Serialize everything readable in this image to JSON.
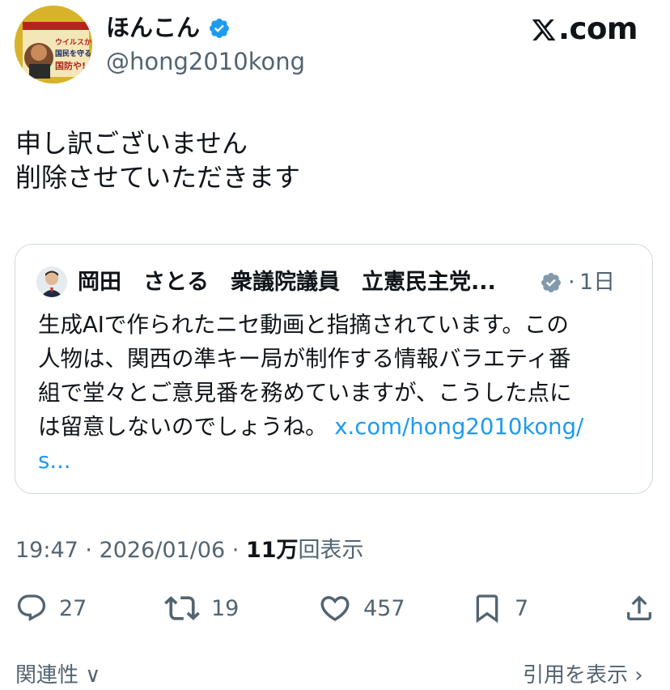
{
  "author": {
    "name": "ほんこん",
    "handle": "@hong2010kong",
    "avatar_text": "ウイルスから国民を守るのも国防や!"
  },
  "brand": {
    "label": ".com"
  },
  "tweet": {
    "lines": [
      "申し訳ございません",
      "削除させていただきます"
    ]
  },
  "quote": {
    "author": "岡田　さとる　衆議院議員　立憲民主党...",
    "dot": "·",
    "time": "1日",
    "lines": [
      "生成AIで作られたニセ動画と指摘されています。この",
      "人物は、関西の準キー局が制作する情報バラエティ番",
      "組で堂々とご意見番を務めていますが、こうした点に",
      "は留意しないのでしょうね。"
    ],
    "link_part1": "x.com/hong2010kong/",
    "link_part2": "s..."
  },
  "meta": {
    "time": "19:47",
    "sep": " · ",
    "date": "2026/01/06",
    "views_count": "11万",
    "views_label": "回表示"
  },
  "actions": {
    "replies": "27",
    "retweets": "19",
    "likes": "457",
    "bookmarks": "7"
  },
  "bottom": {
    "left": "関連性 ∨",
    "right": "引用を表示 ›"
  },
  "colors": {
    "link": "#1d9bf0",
    "verified": "#1d9bf0",
    "secondary_text": "#536471",
    "border": "#cfd9de"
  }
}
